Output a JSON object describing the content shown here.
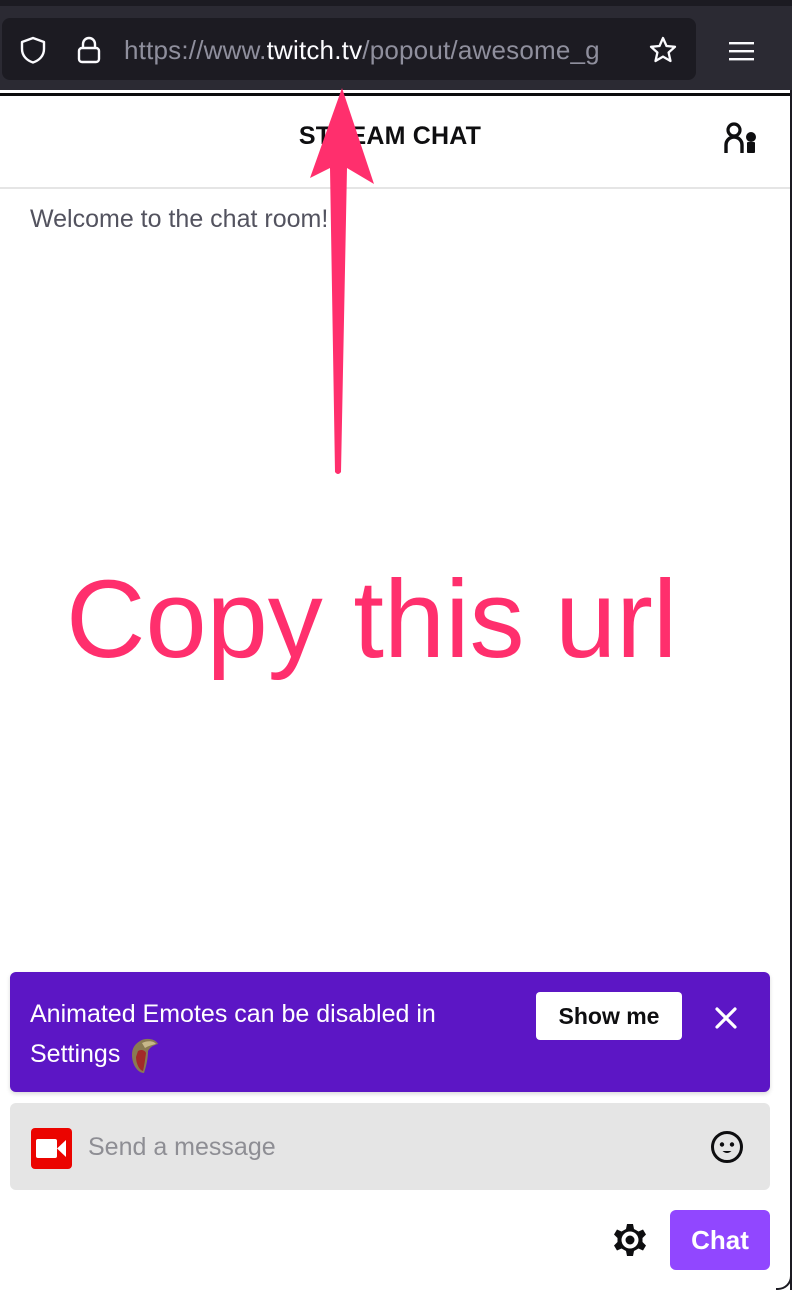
{
  "browser": {
    "url_prefix": "https://www.",
    "url_host": "twitch.tv",
    "url_path": "/popout/awesome_g",
    "icons": [
      "shield-icon",
      "lock-icon",
      "star-icon",
      "hamburger-menu-icon"
    ]
  },
  "chat": {
    "title": "STREAM CHAT",
    "welcome_message": "Welcome to the chat room!",
    "notice": {
      "text": "Animated Emotes can be disabled in Settings",
      "show_me_label": "Show me",
      "background": "#5c16c5"
    },
    "input": {
      "placeholder": "Send a message",
      "value": ""
    },
    "send_label": "Chat",
    "accent": "#9147ff"
  },
  "annotation": {
    "text": "Copy this url",
    "color": "#ff2f6d"
  }
}
